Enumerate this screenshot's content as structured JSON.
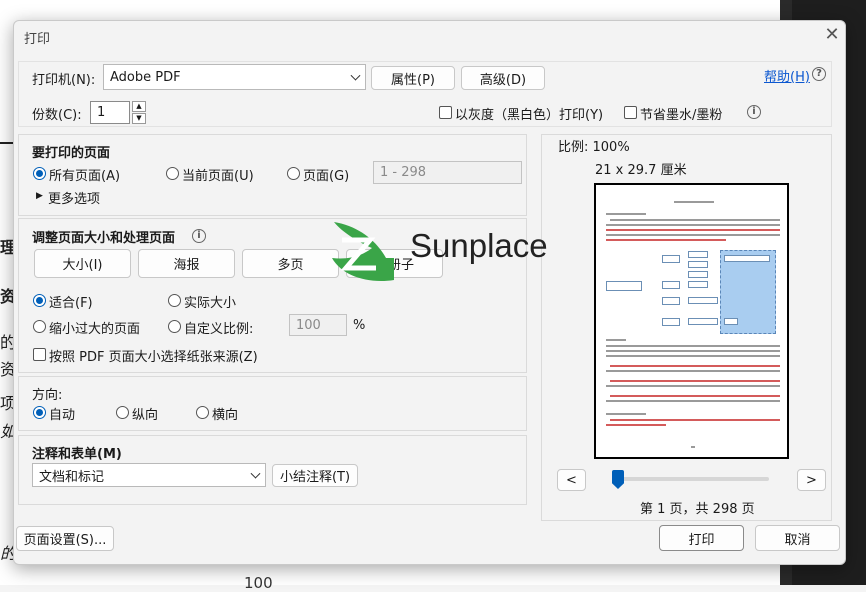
{
  "background": {
    "page_number": "100"
  },
  "dialog": {
    "title": "打印",
    "help_label": "帮助(H)",
    "printer_label": "打印机(N):",
    "printer_value": "Adobe PDF",
    "properties_button": "属性(P)",
    "advanced_button": "高级(D)",
    "copies_label": "份数(C):",
    "copies_value": "1",
    "grayscale_label": "以灰度（黑白色）打印(Y)",
    "save_ink_label": "节省墨水/墨粉",
    "pages": {
      "heading": "要打印的页面",
      "all_pages": "所有页面(A)",
      "current_page": "当前页面(U)",
      "pages_option": "页面(G)",
      "pages_range_placeholder": "1 - 298",
      "more_options": "更多选项"
    },
    "sizing": {
      "heading": "调整页面大小和处理页面",
      "tabs": [
        "大小(I)",
        "海报",
        "多页",
        "小册子"
      ],
      "fit": "适合(F)",
      "actual_size": "实际大小",
      "shrink_oversized": "缩小过大的页面",
      "custom_scale": "自定义比例:",
      "custom_scale_value": "100",
      "percent": "%",
      "choose_paper_source": "按照 PDF 页面大小选择纸张来源(Z)"
    },
    "orientation": {
      "heading": "方向:",
      "auto": "自动",
      "portrait": "纵向",
      "landscape": "横向"
    },
    "comments": {
      "heading": "注释和表单(M)",
      "select_value": "文档和标记",
      "summarize_button": "小结注释(T)"
    },
    "preview": {
      "scale_label": "比例:  100%",
      "paper_size": "21 x 29.7 厘米",
      "prev_button": "<",
      "next_button": ">",
      "page_info": "第 1 页，共 298 页"
    },
    "page_setup_button": "页面设置(S)...",
    "print_button": "打印",
    "cancel_button": "取消"
  },
  "watermark": {
    "text": "Sunplace",
    "accent_color": "#3aa548"
  },
  "colors": {
    "accent": "#005fb8",
    "link": "#0b57d0"
  }
}
